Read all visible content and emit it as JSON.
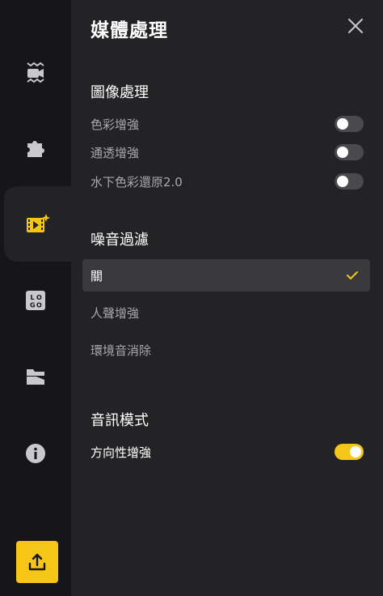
{
  "panel": {
    "title": "媒體處理",
    "close_icon": "close-icon"
  },
  "image_processing": {
    "heading": "圖像處理",
    "items": [
      {
        "label": "色彩增強",
        "on": false
      },
      {
        "label": "通透增強",
        "on": false
      },
      {
        "label": "水下色彩還原2.0",
        "on": false
      }
    ]
  },
  "noise_filter": {
    "heading": "噪音過濾",
    "options": [
      {
        "label": "關",
        "selected": true
      },
      {
        "label": "人聲增強",
        "selected": false
      },
      {
        "label": "環境音消除",
        "selected": false
      }
    ]
  },
  "audio_mode": {
    "heading": "音訊模式",
    "items": [
      {
        "label": "方向性增強",
        "on": true
      }
    ]
  },
  "sidebar": {
    "items": [
      {
        "icon": "underwater-camera-icon",
        "active": false
      },
      {
        "icon": "puzzle-icon",
        "active": false
      },
      {
        "icon": "media-sparkle-icon",
        "active": true
      },
      {
        "icon": "logo-icon",
        "active": false
      },
      {
        "icon": "folder-icon",
        "active": false
      },
      {
        "icon": "info-icon",
        "active": false
      }
    ],
    "upload_icon": "upload-icon"
  },
  "colors": {
    "accent": "#f5c518",
    "background": "#232325",
    "sidebar": "#161618",
    "muted_text": "#a9a9ad",
    "toggle_off": "#4a4a4e"
  }
}
